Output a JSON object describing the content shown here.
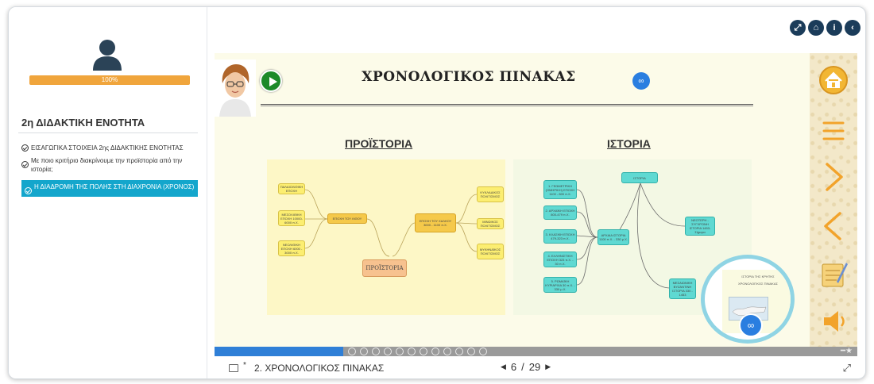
{
  "sidebar": {
    "progress_label": "100%",
    "progress_value": 1.0,
    "unit_title": "2η ΔΙΔΑΚΤΙΚΗ ΕΝΟΤΗΤΑ",
    "lessons": [
      {
        "label": "ΕΙΣΑΓΩΓΙΚΑ ΣΤΟΙΧΕΙΑ 2ης ΔΙΔΑΚΤΙΚΗΣ ΕΝΟΤΗΤΑΣ"
      },
      {
        "label": "Με ποιο κριτήριο διακρίνουμε την προϊστορία από την ιστορία;"
      },
      {
        "label": "Η ΔΙΑΔΡΟΜΗ ΤΗΣ ΠΟΛΗΣ ΣΤΗ ΔΙΑΧΡΟΝΙΑ (ΧΡΟΝΟΣ)"
      }
    ]
  },
  "top_icons": [
    "expand-icon",
    "home-icon",
    "info-icon",
    "back-icon"
  ],
  "slide": {
    "title": "ΧΡΟΝΟΛΟΓΙΚΟΣ ΠΙΝΑΚΑΣ",
    "prehistory_title": "ΠΡΟΪΣΤΟΡΙΑ",
    "history_title": "ΙΣΤΟΡΙΑ",
    "prehistory_nodes": {
      "n1": "ΠΑΛΑΙΟΛΙΘΙΚΗ ΕΠΟΧΗ",
      "n2": "ΜΕΣΟΛΙΘΙΚΗ ΕΠΟΧΗ 10000-6000 π.Χ.",
      "n3": "ΝΕΟΛΙΘΙΚΗ ΕΠΟΧΗ 6000 - 3000 π.Χ.",
      "n4": "ΕΠΟΧΗ ΤΟΥ ΛΙΘΟΥ",
      "n5": "ΕΠΟΧΗ ΤΟΥ ΧΑΛΚΟΥ 3000 - 1100 π.Χ.",
      "n6": "ΚΥΚΛΑΔΙΚΟΣ ΠΟΛΙΤΙΣΜΟΣ",
      "n7": "ΜΙΝΩΙΚΟΣ ΠΟΛΙΤΙΣΜΟΣ",
      "n8": "ΜΥΚΗΝΑΪΚΟΣ ΠΟΛΙΤΙΣΜΟΣ",
      "center": "ΠΡΟΪΣΤΟΡΙΑ"
    },
    "history_nodes": {
      "root": "ΙΣΤΟΡΙΑ",
      "h1": "1. ΓΕΩΜΕΤΡΙΚΗ (ΟΜΗΡΙΚΗ) ΕΠΟΧΗ 1100 - 800 π.Χ.",
      "h2": "2. ΑΡΧΑΪΚΗ ΕΠΟΧΗ 800-479 π.Χ.",
      "h3": "3. ΚΛΑΣΙΚΗ ΕΠΟΧΗ 479-323 π.Χ.",
      "h4": "4. ΕΛΛΗΝΙΣΤΙΚΗ ΕΠΟΧΗ 323 π.Χ. - 30 π.Χ.",
      "h5": "5. ΡΩΜΑΪΚΗ ΚΥΡΙΑΡΧΙΑ 30 π.Χ. - 330 μ.Χ.",
      "ancient": "ΑΡΧΑΙΑ ΙΣΤΟΡΙΑ 1100 π.Χ. - 330 μ.Χ.",
      "modern": "ΝΕΟΤΕΡΗ - ΣΥΓΧΡΟΝΗ ΙΣΤΟΡΙΑ 1453-Σήμερα",
      "byzantine": "ΜΕΣΑΙΩΝΙΚΗ ΒΥΖΑΝΤΙΝΗ ΙΣΤΟΡΙΑ 330 - 1453"
    },
    "preview": {
      "line1": "ΙΣΤΟΡΙΑ ΤΗΣ ΚΡΗΤΗΣ",
      "line2": "ΧΡΟΝΟΛΟΓΙΚΟΣ ΠΙΝΑΚΑΣ"
    }
  },
  "right_bar_icons": [
    "home-icon",
    "menu-icon",
    "next-icon",
    "previous-icon",
    "notes-icon",
    "sound-icon"
  ],
  "navigation": {
    "progress_fraction": 0.2,
    "dot_count": 12
  },
  "footer": {
    "marker": "*",
    "slide_title": "2. ΧΡΟΝΟΛΟΓΙΚΟΣ ΠΙΝΑΚΑΣ",
    "current_page": "6",
    "separator": "/",
    "total_pages": "29"
  }
}
